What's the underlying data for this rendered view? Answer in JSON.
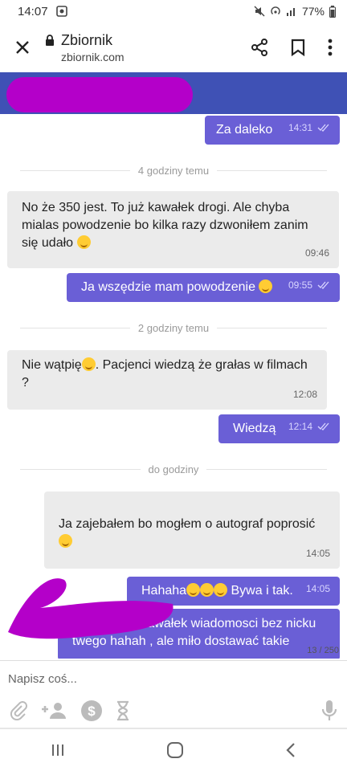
{
  "status": {
    "time": "14:07",
    "battery": "77%"
  },
  "browser": {
    "title": "Zbiornik",
    "url": "zbiornik.com"
  },
  "messages": [
    {
      "id": "m1",
      "dir": "out",
      "text": "Za daleko",
      "time": "14:31"
    },
    {
      "id": "d1",
      "divider": "4 godziny temu"
    },
    {
      "id": "m2",
      "dir": "in",
      "text": "No że 350 jest. To już kawałek drogi. Ale chyba mialas powodzenie bo kilka razy dzwoniłem zanim się udało",
      "time": "09:46"
    },
    {
      "id": "m3",
      "dir": "out",
      "text": "Ja wszędzie mam powodzenie",
      "time": "09:55"
    },
    {
      "id": "d2",
      "divider": "2 godziny temu"
    },
    {
      "id": "m4",
      "dir": "in",
      "text_a": "Nie wątpię",
      "text_b": ". Pacjenci wiedzą że grałas w filmach ?",
      "time": "12:08"
    },
    {
      "id": "m5",
      "dir": "out",
      "text": "Wiedzą",
      "time": "12:14"
    },
    {
      "id": "d3",
      "divider": "do godziny"
    },
    {
      "id": "m6",
      "dir": "in",
      "text": "Ja zajebałem bo mogłem o autograf poprosić",
      "time": "14:05"
    },
    {
      "id": "m7",
      "dir": "out",
      "text_a": "Hahaha",
      "text_b": " Bywa i tak.",
      "time": "14:05"
    },
    {
      "id": "m8",
      "dir": "out",
      "text": "Udostępnie kawałek wiadomosci bez nicku twego hahah , ale miło dostawać takie"
    }
  ],
  "counter": "13 / 250",
  "input": {
    "placeholder": "Napisz coś..."
  },
  "colors": {
    "outgoing": "#6a5fd6",
    "incoming": "#ebebeb",
    "header_band": "#3f51b5",
    "scribble": "#b400c9"
  },
  "icons": [
    "close-icon",
    "lock-icon",
    "share-icon",
    "bookmark-icon",
    "more-vert-icon",
    "attach-icon",
    "add-user-icon",
    "money-icon",
    "hourglass-icon",
    "mic-icon"
  ]
}
